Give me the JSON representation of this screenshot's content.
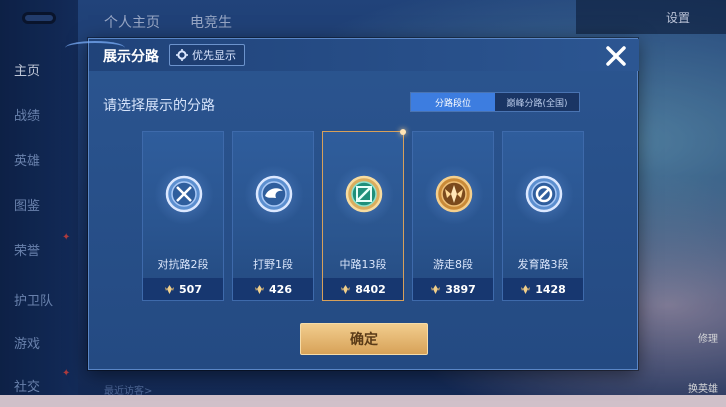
{
  "background": {
    "top_tabs": [
      "个人主页",
      "电竞生"
    ],
    "settings_label": "设置",
    "nav_items": [
      "主页",
      "战绩",
      "英雄",
      "图鉴",
      "荣誉",
      "护卫队",
      "游戏",
      "社交"
    ],
    "recent_label": "最近访客>",
    "right_labels": [
      "修理",
      "换英雄"
    ]
  },
  "modal": {
    "title": "展示分路",
    "priority_label": "优先显示",
    "prompt": "请选择展示的分路",
    "toggle": [
      "分路段位",
      "巅峰分路(全国)"
    ],
    "lanes": [
      {
        "name": "对抗路2段",
        "score": "507",
        "icon": "clash-lane-icon",
        "selected": false
      },
      {
        "name": "打野1段",
        "score": "426",
        "icon": "jungle-icon",
        "selected": false
      },
      {
        "name": "中路13段",
        "score": "8402",
        "icon": "mid-lane-icon",
        "selected": true
      },
      {
        "name": "游走8段",
        "score": "3897",
        "icon": "roam-icon",
        "selected": false
      },
      {
        "name": "发育路3段",
        "score": "1428",
        "icon": "farm-lane-icon",
        "selected": false
      }
    ],
    "confirm_label": "确定"
  },
  "colors": {
    "accent_blue": "#3d7de0",
    "selected_border": "#d7a05a",
    "confirm_gold": "#e0b26a"
  }
}
